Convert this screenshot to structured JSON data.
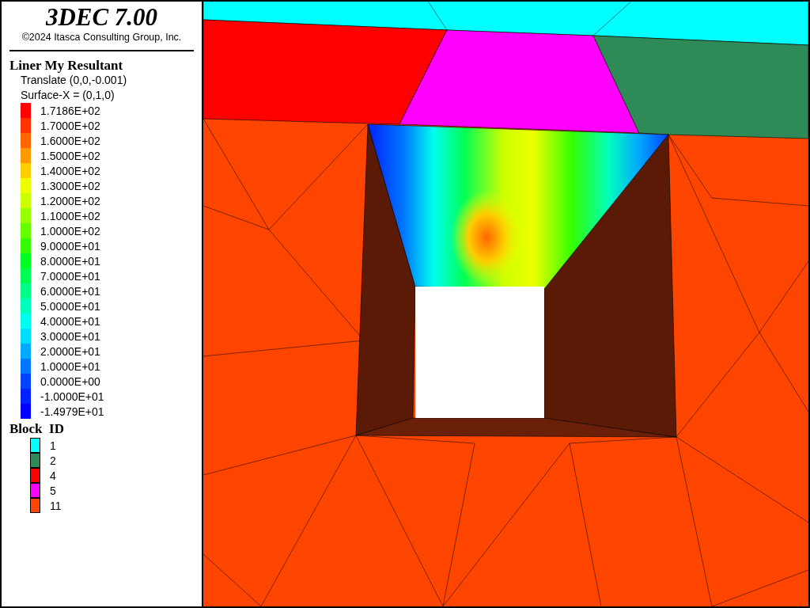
{
  "title": "3DEC 7.00",
  "copyright": "©2024 Itasca Consulting Group, Inc.",
  "contour": {
    "title": "Liner My Resultant",
    "notes": [
      "Translate (0,0,-0.001)",
      "Surface-X = (0,1,0)"
    ],
    "levels": [
      {
        "label": "1.7186E+02",
        "color": "#ff0000"
      },
      {
        "label": "1.7000E+02",
        "color": "#ff3300"
      },
      {
        "label": "1.6000E+02",
        "color": "#ff6600"
      },
      {
        "label": "1.5000E+02",
        "color": "#ff9900"
      },
      {
        "label": "1.4000E+02",
        "color": "#ffcc00"
      },
      {
        "label": "1.3000E+02",
        "color": "#eeff00"
      },
      {
        "label": "1.2000E+02",
        "color": "#ccff00"
      },
      {
        "label": "1.1000E+02",
        "color": "#99ff00"
      },
      {
        "label": "1.0000E+02",
        "color": "#66ff00"
      },
      {
        "label": "9.0000E+01",
        "color": "#33ff00"
      },
      {
        "label": "8.0000E+01",
        "color": "#00ff22"
      },
      {
        "label": "7.0000E+01",
        "color": "#00ff55"
      },
      {
        "label": "6.0000E+01",
        "color": "#00ff88"
      },
      {
        "label": "5.0000E+01",
        "color": "#00ffbb"
      },
      {
        "label": "4.0000E+01",
        "color": "#00ffee"
      },
      {
        "label": "3.0000E+01",
        "color": "#00ddff"
      },
      {
        "label": "2.0000E+01",
        "color": "#00aaff"
      },
      {
        "label": "1.0000E+01",
        "color": "#0077ff"
      },
      {
        "label": "0.0000E+00",
        "color": "#0044ff"
      },
      {
        "label": "-1.0000E+01",
        "color": "#0022ff"
      },
      {
        "label": "-1.4979E+01",
        "color": "#0000ff"
      }
    ]
  },
  "blocks": {
    "title": "Block  ID",
    "items": [
      {
        "label": "1",
        "color": "#00ffff"
      },
      {
        "label": "2",
        "color": "#2e8b57"
      },
      {
        "label": "4",
        "color": "#ff0000"
      },
      {
        "label": "5",
        "color": "#ff00ff"
      },
      {
        "label": "11",
        "color": "#ff4500"
      }
    ]
  }
}
